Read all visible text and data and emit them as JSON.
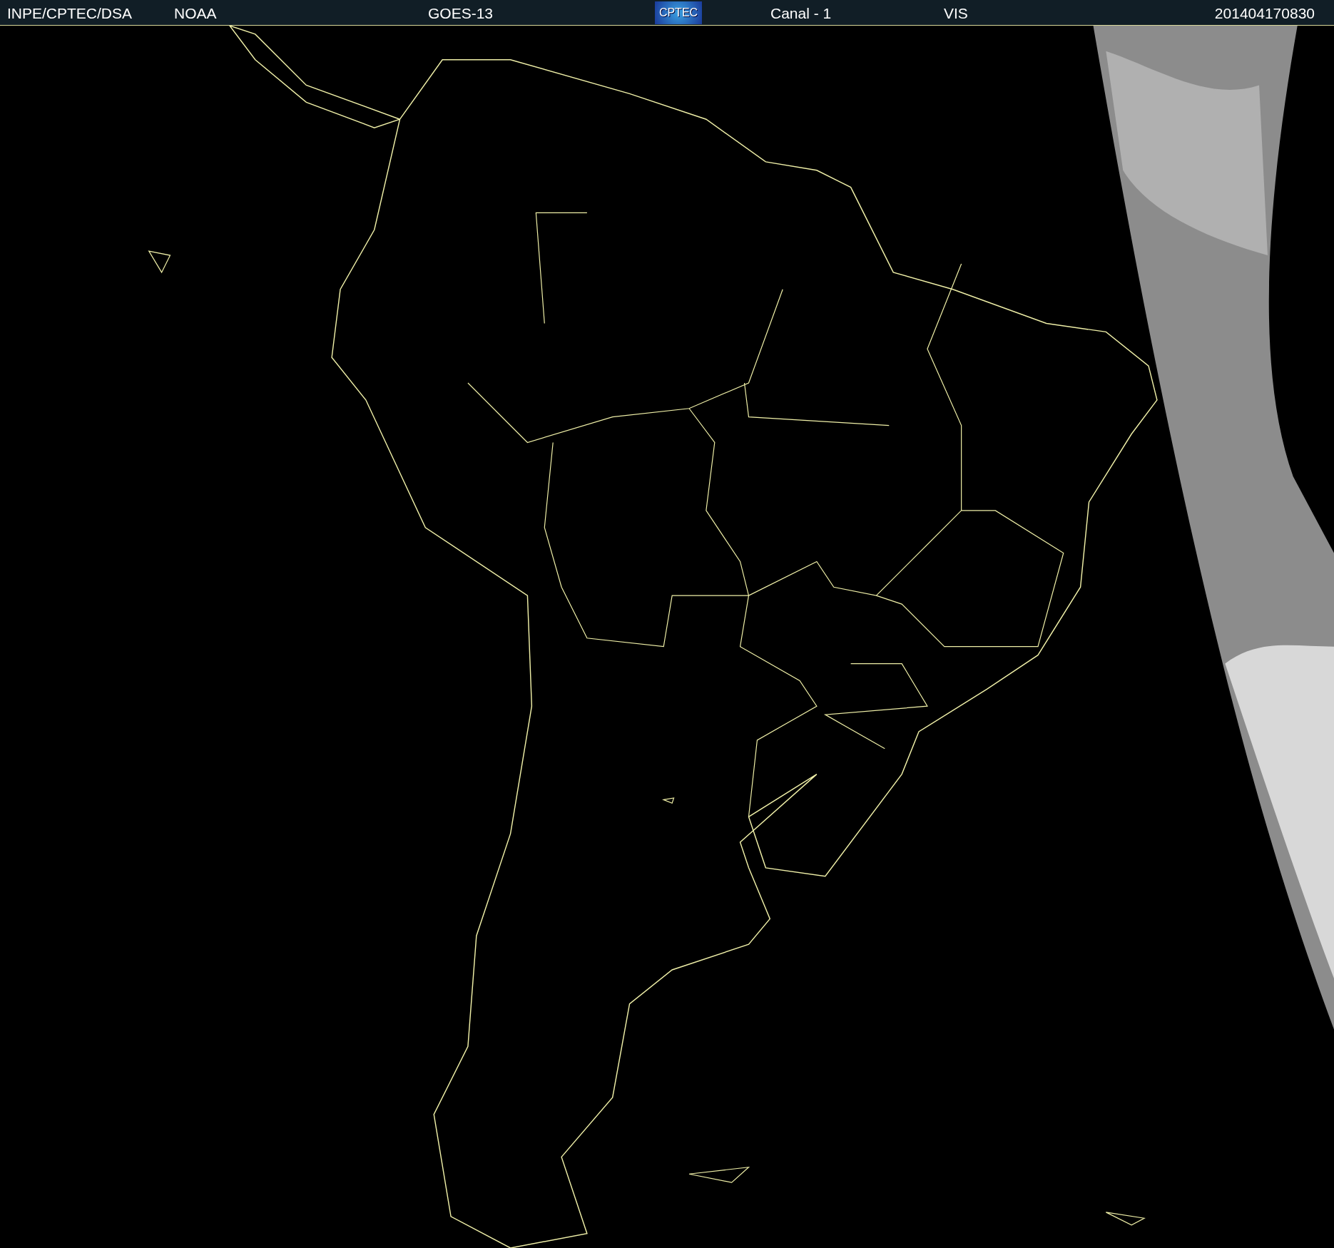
{
  "header": {
    "labels": [
      {
        "text": "INPE/CPTEC/DSA"
      },
      {
        "text": "NOAA"
      },
      {
        "text": "GOES-13"
      }
    ],
    "logo": "CPTEC",
    "labels_after_logo": [
      {
        "text": "Canal - 1"
      },
      {
        "text": "VIS"
      }
    ],
    "timestamp": "201404170830"
  }
}
